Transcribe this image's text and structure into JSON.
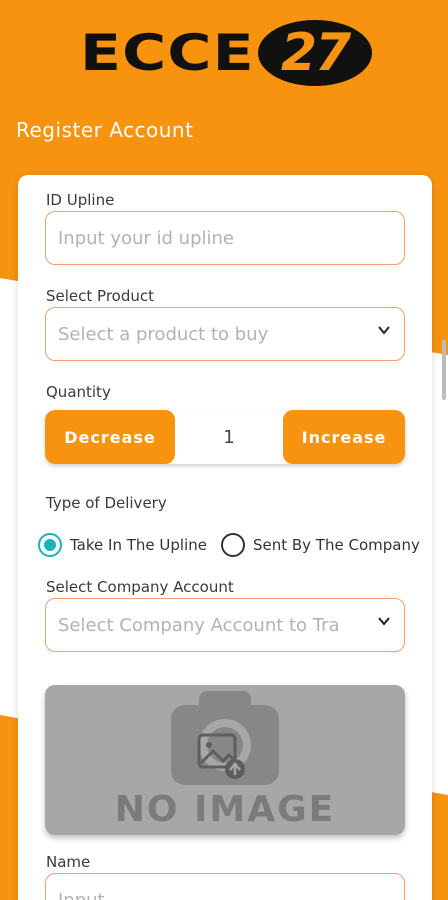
{
  "brand": {
    "logo_text": "ECCE",
    "logo_badge": "27",
    "accent_color": "#f7930e"
  },
  "page": {
    "title": "Register Account"
  },
  "form": {
    "upline": {
      "label": "ID Upline",
      "placeholder": "Input your id upline"
    },
    "product": {
      "label": "Select Product",
      "placeholder": "Select a product to buy"
    },
    "quantity": {
      "label": "Quantity",
      "decrease_label": "Decrease",
      "value": "1",
      "increase_label": "Increase"
    },
    "delivery": {
      "label": "Type of Delivery",
      "options": [
        {
          "label": "Take In The Upline",
          "selected": true
        },
        {
          "label": "Sent By The Company",
          "selected": false
        }
      ]
    },
    "company_account": {
      "label": "Select Company Account",
      "placeholder": "Select Company Account to Tra"
    },
    "image": {
      "placeholder_text": "NO IMAGE",
      "icon": "camera-icon"
    },
    "name": {
      "label": "Name",
      "placeholder": "Input"
    }
  }
}
